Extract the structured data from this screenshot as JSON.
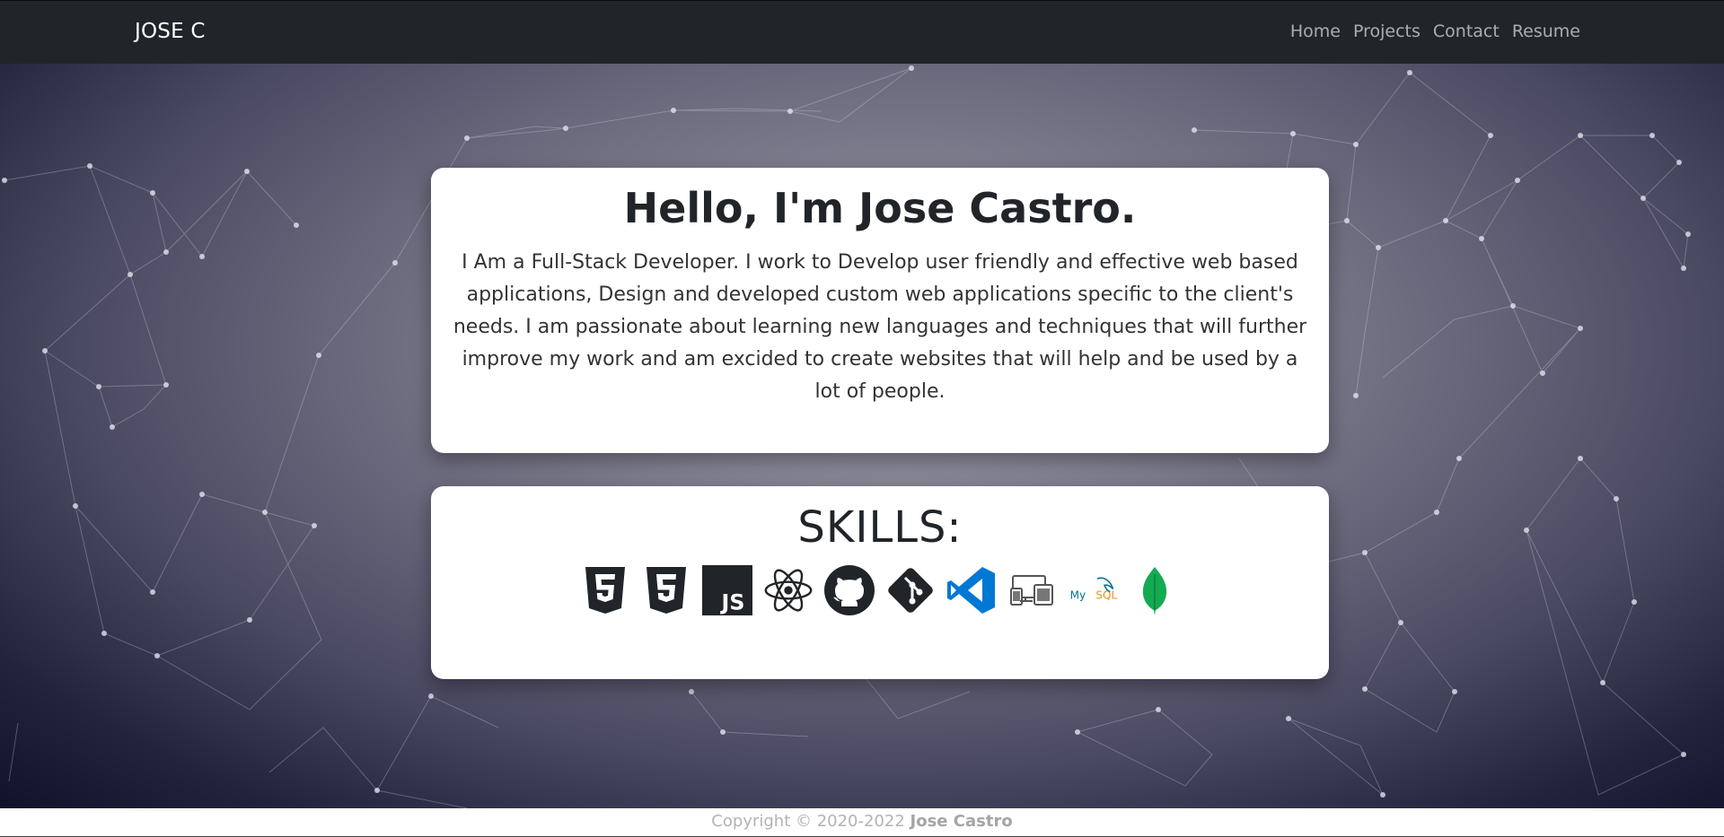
{
  "navbar": {
    "brand": "JOSE C",
    "links": [
      "Home",
      "Projects",
      "Contact",
      "Resume"
    ]
  },
  "about": {
    "title": "Hello, I'm Jose Castro.",
    "text": "I Am a Full-Stack Developer. I work to Develop user friendly and effective web based applications, Design and developed custom web applications specific to the client's needs. I am passionate about learning new languages and techniques that will further improve my work and am excided to create websites that will help and be used by a lot of people."
  },
  "skills": {
    "title": "SKILLS:",
    "icons": [
      "html5-icon",
      "css3-icon",
      "javascript-icon",
      "react-icon",
      "github-icon",
      "git-icon",
      "vscode-icon",
      "responsive-devices-icon",
      "mysql-icon",
      "mongodb-icon"
    ],
    "mysql_label": "MySQL"
  },
  "footer": {
    "copyright": "Copyright © 2020-2022",
    "author": "Jose Castro"
  },
  "colors": {
    "navbar": "#212529",
    "vscode_blue": "#0078d4",
    "mysql_blue": "#00758f",
    "mysql_orange": "#f29111",
    "mongodb_green": "#13aa52"
  }
}
